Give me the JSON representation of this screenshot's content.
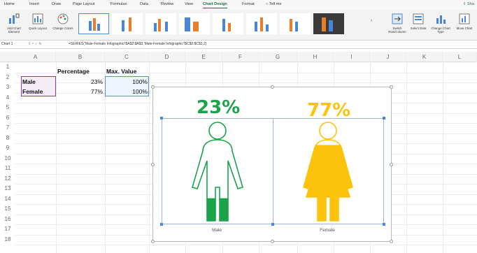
{
  "ribbon_tabs": [
    "Home",
    "Insert",
    "Draw",
    "Page Layout",
    "Formulas",
    "Data",
    "Review",
    "View",
    "Chart Design",
    "Format",
    "Tell me"
  ],
  "active_tab": "Chart Design",
  "share_label": "Sha",
  "ribbon_buttons": {
    "add_chart_element": "Add Chart Element",
    "quick_layout": "Quick Layout",
    "change_colors": "Change Colors",
    "switch_row_column": "Switch Row/Column",
    "select_data": "Select Data",
    "change_chart_type": "Change Chart Type",
    "move_chart": "Move Chart"
  },
  "formula_bar": {
    "name_box": "Chart 1",
    "formula": "=SERIES('Male-Female Infographic'!$A$2:$A$3,'Male-Female Infographic'!$C$2:$C$3,2)"
  },
  "columns": [
    "A",
    "B",
    "C",
    "D",
    "E",
    "F",
    "G",
    "H",
    "I",
    "J",
    "K",
    "L"
  ],
  "rows": [
    "1",
    "2",
    "3",
    "4",
    "5",
    "6",
    "7",
    "8",
    "9",
    "10",
    "11",
    "12",
    "13",
    "14",
    "15",
    "16",
    "17",
    "18"
  ],
  "table": {
    "headers": {
      "percentage": "Percentage",
      "max_value": "Max. Value"
    },
    "rows": [
      {
        "label": "Male",
        "percentage": "23%",
        "max": "100%"
      },
      {
        "label": "Female",
        "percentage": "77%",
        "max": "100%"
      }
    ]
  },
  "colors": {
    "male": "#1aa34a",
    "female": "#fdc20b",
    "accent": "#1e7145"
  },
  "chart_data": {
    "type": "bar",
    "categories": [
      "Male",
      "Female"
    ],
    "series": [
      {
        "values": [
          23,
          77
        ]
      },
      {
        "values": [
          100,
          100
        ]
      }
    ],
    "data_labels": [
      "23%",
      "77%"
    ]
  }
}
